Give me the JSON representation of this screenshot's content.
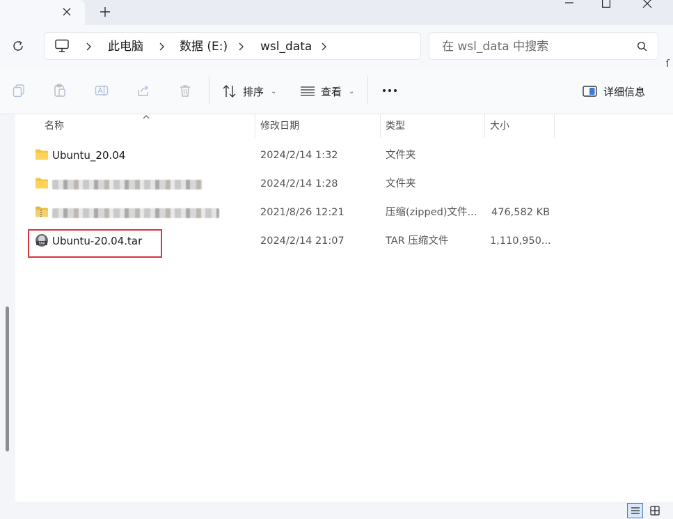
{
  "tabbar": {
    "close_icon": "close-icon",
    "new_tab_icon": "plus-icon"
  },
  "window": {
    "minimize_icon": "minimize-icon",
    "maximize_icon": "maximize-icon",
    "close_icon": "close-icon"
  },
  "address": {
    "breadcrumbs": [
      "此电脑",
      "数据 (E:)",
      "wsl_data"
    ]
  },
  "search": {
    "placeholder": "在 wsl_data 中搜索"
  },
  "toolbar": {
    "sort_label": "排序",
    "view_label": "查看",
    "more_label": "•••",
    "details_label": "详细信息"
  },
  "columns": {
    "name": "名称",
    "modified": "修改日期",
    "type": "类型",
    "size": "大小"
  },
  "files": [
    {
      "name": "Ubuntu_20.04",
      "date": "2024/2/14 1:32",
      "type": "文件夹",
      "size": "",
      "icon": "folder-icon"
    },
    {
      "name": "",
      "date": "2024/2/14 1:28",
      "type": "文件夹",
      "size": "",
      "icon": "folder-icon"
    },
    {
      "name": "",
      "date": "2021/8/26 12:21",
      "type": "压缩(zipped)文件...",
      "size": "476,582 KB",
      "icon": "zip-folder-icon"
    },
    {
      "name": "Ubuntu-20.04.tar",
      "date": "2024/2/14 21:07",
      "type": "TAR 压缩文件",
      "size": "1,110,950...",
      "icon": "tar-archive-icon"
    }
  ],
  "colors": {
    "accent": "#4a7cc4",
    "highlight_box": "#d9333f",
    "folder": "#f5c242"
  }
}
